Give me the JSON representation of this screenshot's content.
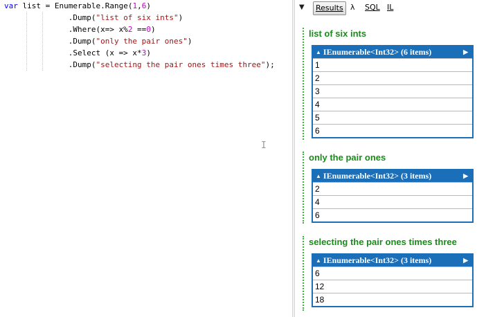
{
  "editor": {
    "lines": [
      {
        "parts": [
          {
            "t": "var",
            "c": "kw"
          },
          {
            "t": " list = Enumerable.Range(",
            "c": ""
          },
          {
            "t": "1",
            "c": "num"
          },
          {
            "t": ",",
            "c": ""
          },
          {
            "t": "6",
            "c": "num"
          },
          {
            "t": ")",
            "c": ""
          }
        ]
      },
      {
        "parts": [
          {
            "t": "              .Dump(",
            "c": ""
          },
          {
            "t": "\"list of six ints\"",
            "c": "str"
          },
          {
            "t": ")",
            "c": ""
          }
        ]
      },
      {
        "parts": [
          {
            "t": "              .Where(x=> x%",
            "c": ""
          },
          {
            "t": "2",
            "c": "num"
          },
          {
            "t": " ==",
            "c": ""
          },
          {
            "t": "0",
            "c": "num"
          },
          {
            "t": ")",
            "c": ""
          }
        ]
      },
      {
        "parts": [
          {
            "t": "              .Dump(",
            "c": ""
          },
          {
            "t": "\"only the pair ones\"",
            "c": "str"
          },
          {
            "t": ")",
            "c": ""
          }
        ]
      },
      {
        "parts": [
          {
            "t": "              .Select (x => x*",
            "c": ""
          },
          {
            "t": "3",
            "c": "num"
          },
          {
            "t": ")",
            "c": ""
          }
        ]
      },
      {
        "parts": [
          {
            "t": "              .Dump(",
            "c": ""
          },
          {
            "t": "\"selecting the pair ones times three\"",
            "c": "str"
          },
          {
            "t": ");",
            "c": ""
          }
        ]
      }
    ],
    "cursor_glyph": "I"
  },
  "toolbar": {
    "collapse_glyph": "▼",
    "results_label": "Results",
    "lambda_label": "λ",
    "sql_label": "SQL",
    "il_label": "IL"
  },
  "dumps": [
    {
      "title": "list of six ints",
      "header": "IEnumerable<Int32> (6 items)",
      "rows": [
        "1",
        "2",
        "3",
        "4",
        "5",
        "6"
      ]
    },
    {
      "title": "only the pair ones",
      "header": "IEnumerable<Int32> (3 items)",
      "rows": [
        "2",
        "4",
        "6"
      ]
    },
    {
      "title": "selecting the pair ones times three",
      "header": "IEnumerable<Int32> (3 items)",
      "rows": [
        "6",
        "12",
        "18"
      ]
    }
  ],
  "colors": {
    "accent": "#1b6fb8",
    "title_green": "#1a8a1a",
    "dotted_green": "#2eb82e"
  }
}
